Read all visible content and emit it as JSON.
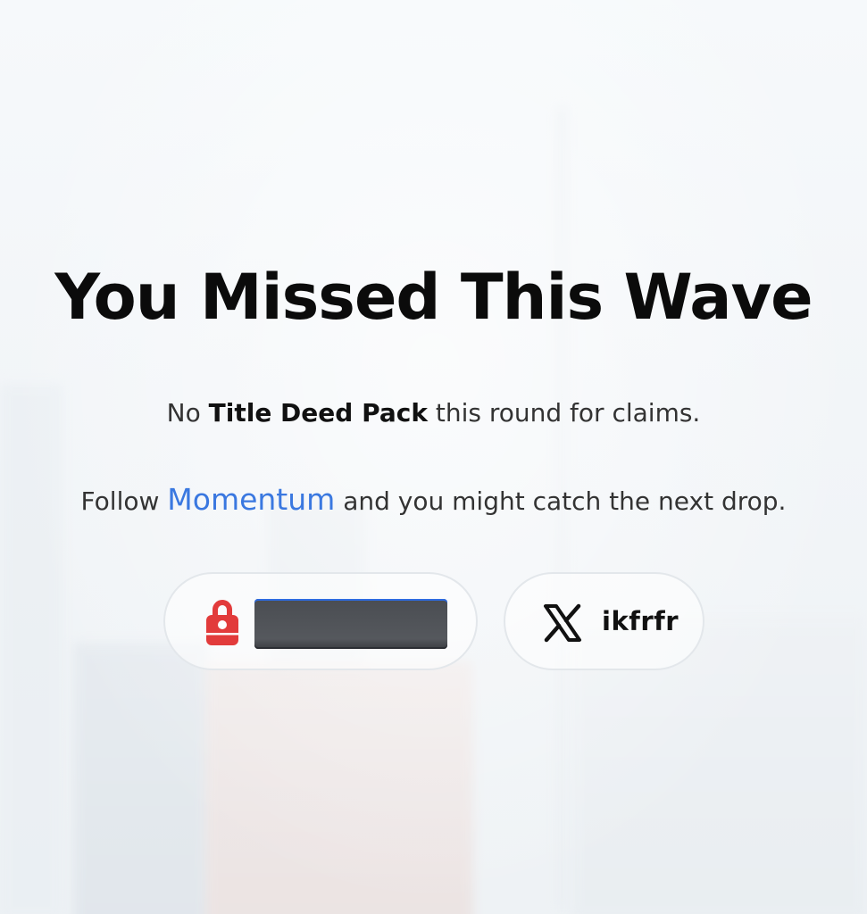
{
  "heading": "You Missed This Wave",
  "message": {
    "line1_prefix": "No",
    "line1_emphasis": "Title Deed Pack",
    "line1_suffix": "this round for claims.",
    "line2_prefix": "Follow",
    "line2_link": "Momentum",
    "line2_suffix": "and you might catch the next drop."
  },
  "accounts": {
    "wallet": {
      "icon": "lock-icon",
      "accent": "#e23b3b",
      "value_redacted": true
    },
    "x": {
      "icon": "x-logo-icon",
      "handle": "ikfrfr"
    }
  },
  "colors": {
    "link": "#3a78e0",
    "heading": "#0b0b0b",
    "body_text": "#333333"
  }
}
